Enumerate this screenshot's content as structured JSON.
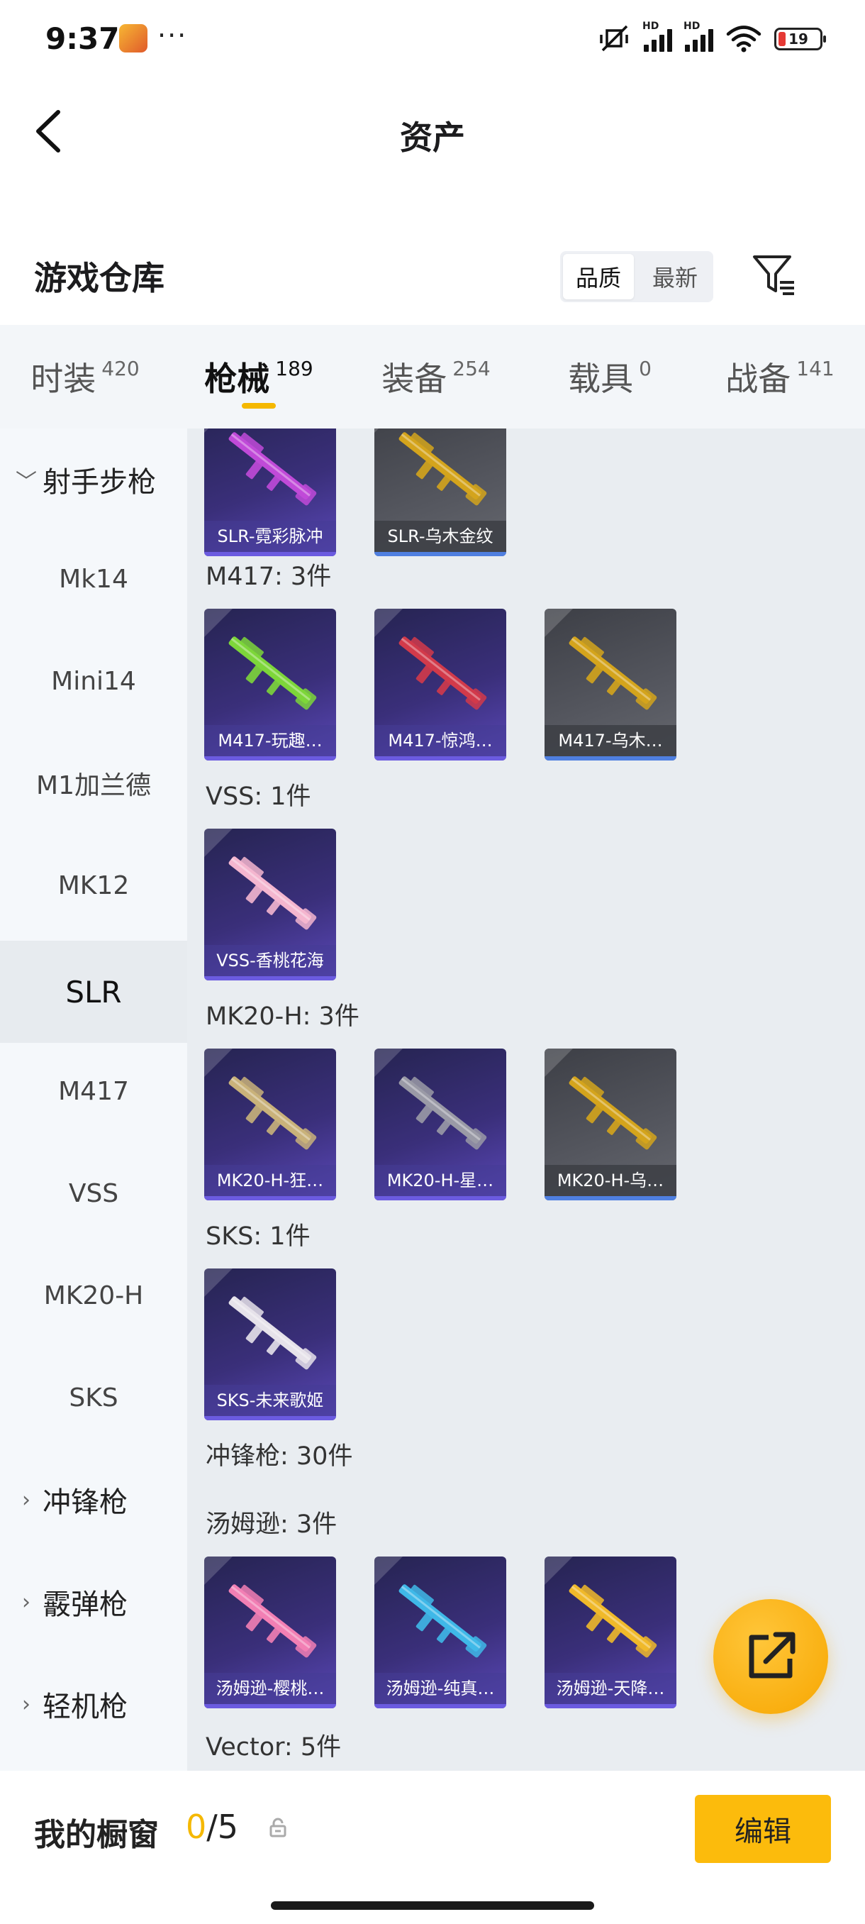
{
  "status_bar": {
    "time": "9:37",
    "more": "···",
    "hd": "HD",
    "battery": "19"
  },
  "header": {
    "title": "资产"
  },
  "section": {
    "title": "游戏仓库",
    "sort_options": [
      "品质",
      "最新"
    ]
  },
  "tabs": [
    {
      "label": "时装",
      "count": "420"
    },
    {
      "label": "枪械",
      "count": "189",
      "active": true
    },
    {
      "label": "装备",
      "count": "254"
    },
    {
      "label": "载具",
      "count": "0"
    },
    {
      "label": "战备",
      "count": "141"
    }
  ],
  "sidebar": {
    "items": [
      {
        "label": "射手步枪",
        "group": true,
        "expanded": true
      },
      {
        "label": "Mk14"
      },
      {
        "label": "Mini14"
      },
      {
        "label": "M1加兰德"
      },
      {
        "label": "MK12"
      },
      {
        "label": "SLR",
        "active": true
      },
      {
        "label": "M417"
      },
      {
        "label": "VSS"
      },
      {
        "label": "MK20-H"
      },
      {
        "label": "SKS"
      },
      {
        "label": "冲锋枪",
        "group": true
      },
      {
        "label": "霰弹枪",
        "group": true
      },
      {
        "label": "轻机枪",
        "group": true
      }
    ]
  },
  "content": {
    "slr_items": [
      {
        "name": "SLR-霓彩脉冲",
        "style": "purple",
        "color": "#c04ad8"
      },
      {
        "name": "SLR-乌木金纹",
        "style": "gray",
        "color": "#d4a41c"
      }
    ],
    "groups": [
      {
        "label": "M417: 3件",
        "items": [
          {
            "name": "M417-玩趣…",
            "style": "purple",
            "color": "#7dd63a"
          },
          {
            "name": "M417-惊鸿…",
            "style": "purple",
            "color": "#d23a4a"
          },
          {
            "name": "M417-乌木…",
            "style": "gray",
            "color": "#d4a41c"
          }
        ]
      },
      {
        "label": "VSS: 1件",
        "items": [
          {
            "name": "VSS-香桃花海",
            "style": "purple",
            "color": "#f4b6cf"
          }
        ]
      },
      {
        "label": "MK20-H: 3件",
        "items": [
          {
            "name": "MK20-H-狂…",
            "style": "purple",
            "color": "#c9b27a"
          },
          {
            "name": "MK20-H-星…",
            "style": "purple",
            "color": "#9a9aa6"
          },
          {
            "name": "MK20-H-乌…",
            "style": "gray",
            "color": "#d4a41c"
          }
        ]
      },
      {
        "label": "SKS: 1件",
        "items": [
          {
            "name": "SKS-未来歌姬",
            "style": "purple",
            "color": "#e6e2ea"
          }
        ]
      }
    ],
    "smg_header": "冲锋枪: 30件",
    "thompson": {
      "label": "汤姆逊: 3件",
      "items": [
        {
          "name": "汤姆逊-樱桃…",
          "style": "purple",
          "color": "#f27fb4"
        },
        {
          "name": "汤姆逊-纯真…",
          "style": "purple",
          "color": "#3fb8e8"
        },
        {
          "name": "汤姆逊-天降…",
          "style": "purple",
          "color": "#f0b92a"
        }
      ]
    },
    "vector_label": "Vector: 5件"
  },
  "bottom": {
    "label": "我的橱窗",
    "current": "0",
    "total": "/5",
    "edit": "编辑"
  },
  "colors": {
    "accent": "#f5b800",
    "card_purple": "#3a2f7a",
    "card_gray": "#55575f"
  }
}
